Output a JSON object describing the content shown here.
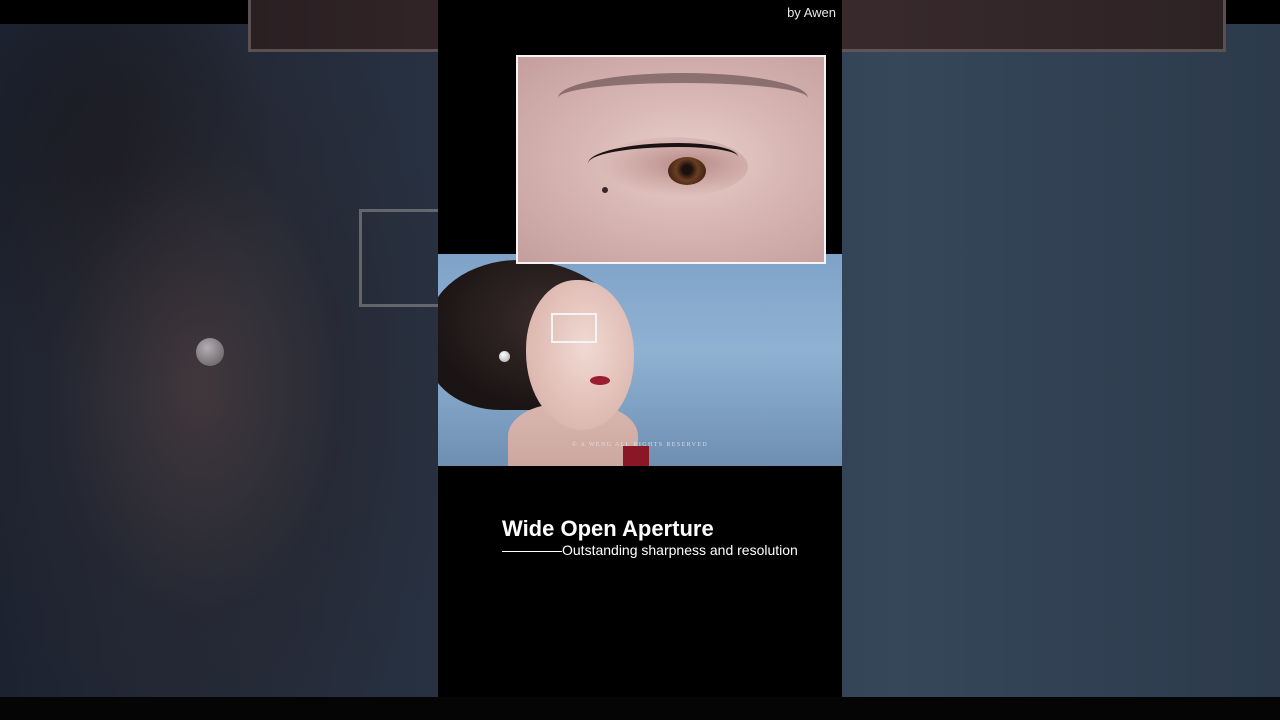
{
  "credit": "by Awen",
  "photo": {
    "watermark": "© A WENG ALL RIGHTS RESERVED"
  },
  "caption": {
    "title": "Wide Open Aperture",
    "subtitle": "Outstanding sharpness and resolution"
  }
}
